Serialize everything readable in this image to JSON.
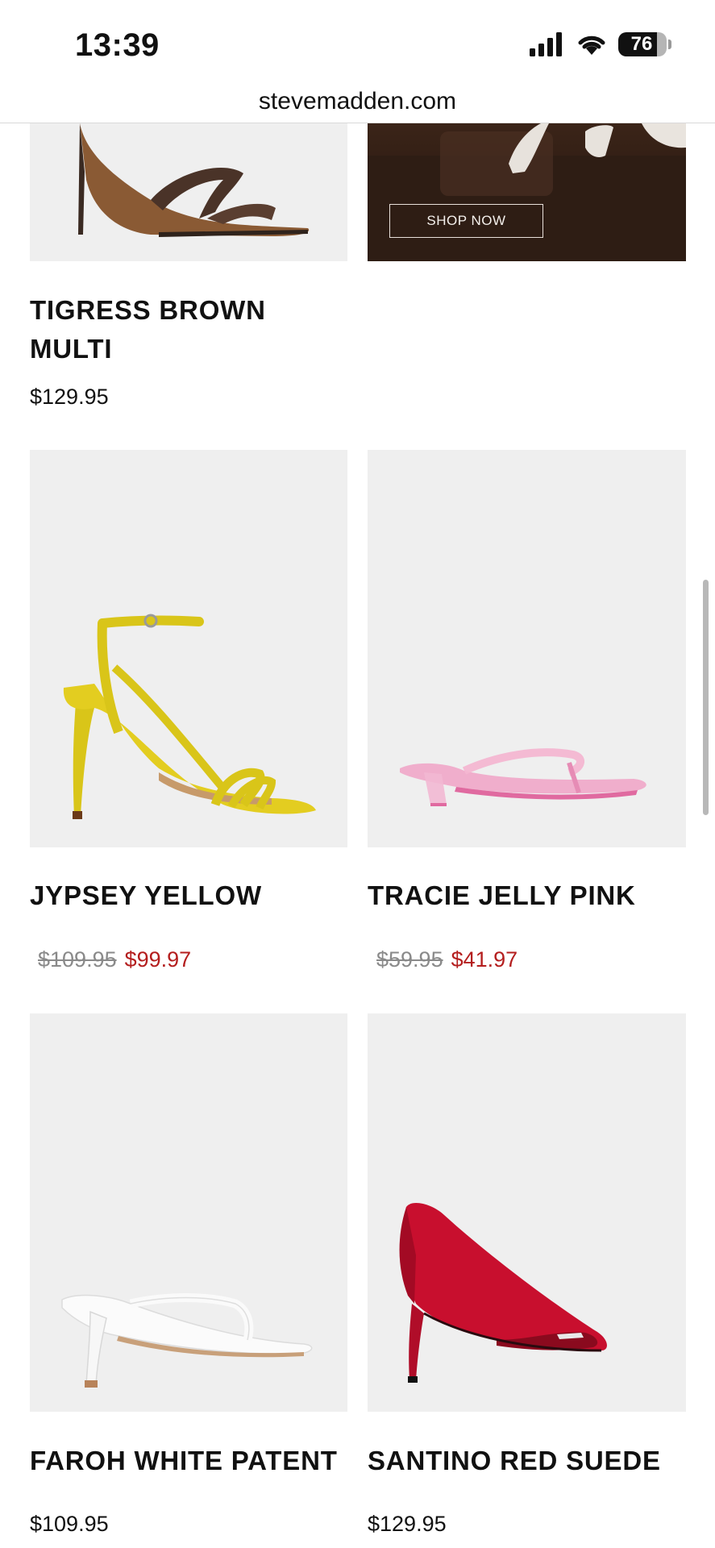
{
  "status_bar": {
    "time": "13:39",
    "battery": "76",
    "icons": [
      "signal-icon",
      "wifi-icon",
      "battery-icon"
    ]
  },
  "browser": {
    "url": "stevemadden.com"
  },
  "promo": {
    "button_label": "SHOP NOW"
  },
  "products": [
    {
      "name": "TIGRESS BROWN MULTI",
      "price": "$129.95",
      "image_icon": "brown-strappy-heel-icon"
    },
    {
      "name": "JYPSEY YELLOW",
      "original_price": "$109.95",
      "sale_price": "$99.97",
      "image_icon": "yellow-ankle-strap-heel-icon"
    },
    {
      "name": "TRACIE JELLY PINK",
      "original_price": "$59.95",
      "sale_price": "$41.97",
      "image_icon": "pink-jelly-thong-mule-icon"
    },
    {
      "name": "FAROH WHITE PATENT",
      "price": "$109.95",
      "image_icon": "white-thong-heel-icon"
    },
    {
      "name": "SANTINO RED SUEDE",
      "price": "$129.95",
      "image_icon": "red-suede-pump-icon"
    }
  ],
  "colors": {
    "sale_red": "#b41e1e",
    "strike_gray": "#8a8a8a",
    "card_bg": "#efefef"
  }
}
